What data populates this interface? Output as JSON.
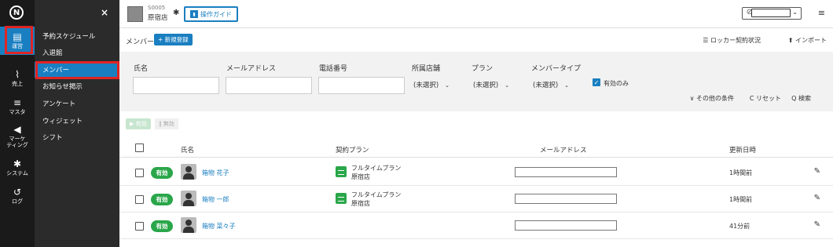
{
  "rail": {
    "logo": "N",
    "items": [
      {
        "label": "運営",
        "icon": "store-icon"
      },
      {
        "label": "売上",
        "icon": "chart-icon"
      },
      {
        "label": "マスタ",
        "icon": "database-icon"
      },
      {
        "label": "マーケ\nティング",
        "icon": "megaphone-icon"
      },
      {
        "label": "システム",
        "icon": "gear-icon"
      },
      {
        "label": "ログ",
        "icon": "history-icon"
      }
    ]
  },
  "menu": {
    "close": "×",
    "items": [
      "予約スケジュール",
      "入退館",
      "メンバー",
      "お知らせ掲示",
      "アンケート",
      "ウィジェット",
      "シフト"
    ],
    "active_index": 2
  },
  "header": {
    "store_code": "S0005",
    "store_name": "原宿店",
    "guide_label": "操作ガイド"
  },
  "member_bar": {
    "title": "メンバー",
    "new_label": "+ 新規登録",
    "locker_label": "☰ ロッカー契約状況",
    "import_label": "⬆ インポート"
  },
  "filter": {
    "name_label": "氏名",
    "email_label": "メールアドレス",
    "phone_label": "電話番号",
    "store_label": "所属店舗",
    "plan_label": "プラン",
    "type_label": "メンバータイプ",
    "store_value": "(未選択)",
    "plan_value": "(未選択)",
    "type_value": "(未選択)",
    "active_only_label": "有効のみ",
    "other_conditions": "∨ その他の条件",
    "reset": "C リセット",
    "search": "Q 検索"
  },
  "actions": {
    "enable": "▶ 有効",
    "disable": "‖ 無効"
  },
  "table": {
    "headers": {
      "name": "氏名",
      "plan": "契約プラン",
      "email": "メールアドレス",
      "updated": "更新日時"
    },
    "rows": [
      {
        "status": "有効",
        "name": "箱物 花子",
        "plan": "フルタイムプラン",
        "store": "原宿店",
        "updated": "1時間前"
      },
      {
        "status": "有効",
        "name": "箱物 一郎",
        "plan": "フルタイムプラン",
        "store": "原宿店",
        "updated": "1時間前"
      },
      {
        "status": "有効",
        "name": "箱物 菜々子",
        "plan": "",
        "store": "",
        "updated": "41分前"
      }
    ]
  },
  "colors": {
    "accent": "#1a7fc1",
    "highlight": "#e02424",
    "status_active": "#2aa64a"
  }
}
